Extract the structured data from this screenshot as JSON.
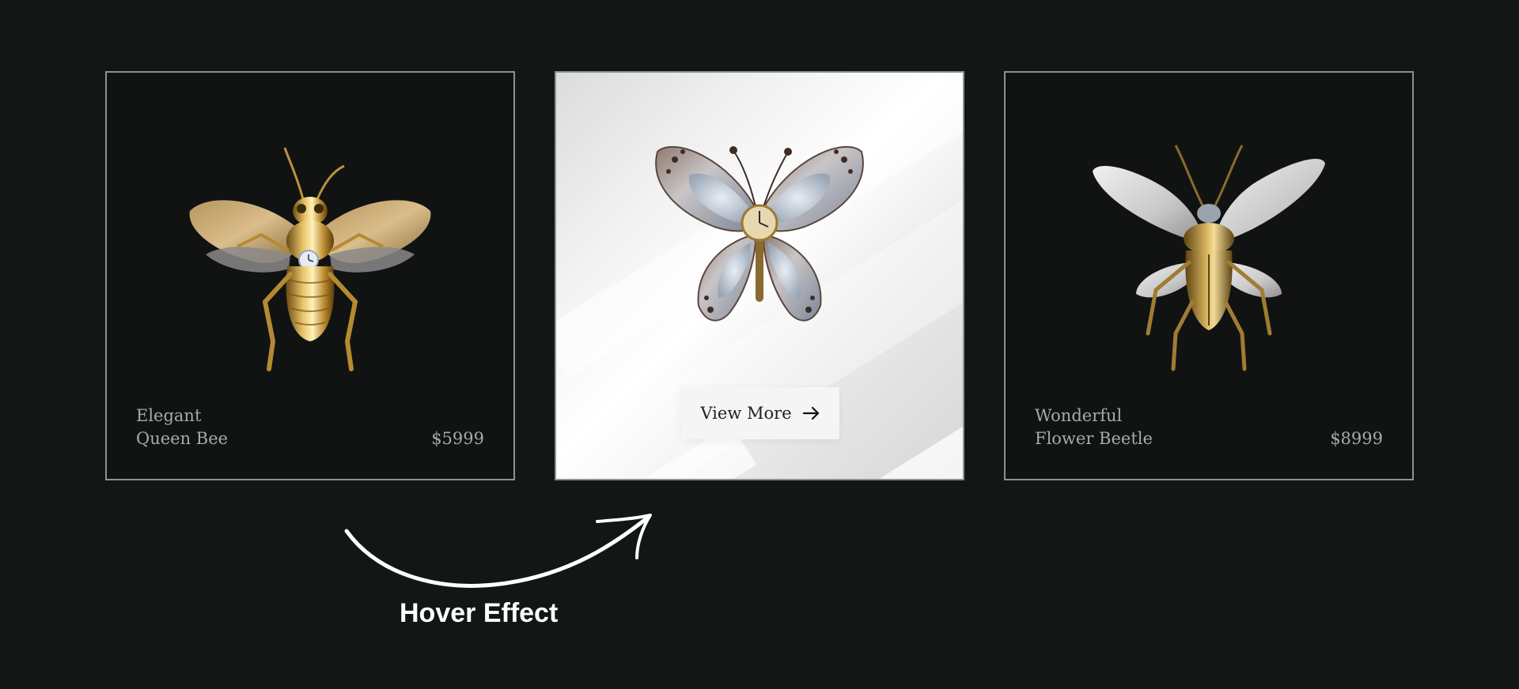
{
  "products": [
    {
      "name_line1": "Elegant",
      "name_line2": "Queen Bee",
      "price": "$5999",
      "icon": "queen-bee-image"
    },
    {
      "button_label": "View More",
      "button_icon": "arrow-right-icon",
      "icon": "butterfly-image"
    },
    {
      "name_line1": "Wonderful",
      "name_line2": "Flower Beetle",
      "price": "$8999",
      "icon": "flower-beetle-image"
    }
  ],
  "annotation": {
    "label": "Hover Effect",
    "icon": "curved-arrow-icon"
  },
  "colors": {
    "background": "#121615",
    "card_border": "#8d918f",
    "text_muted": "#a7aaa8",
    "gold": "#c9a24a"
  }
}
